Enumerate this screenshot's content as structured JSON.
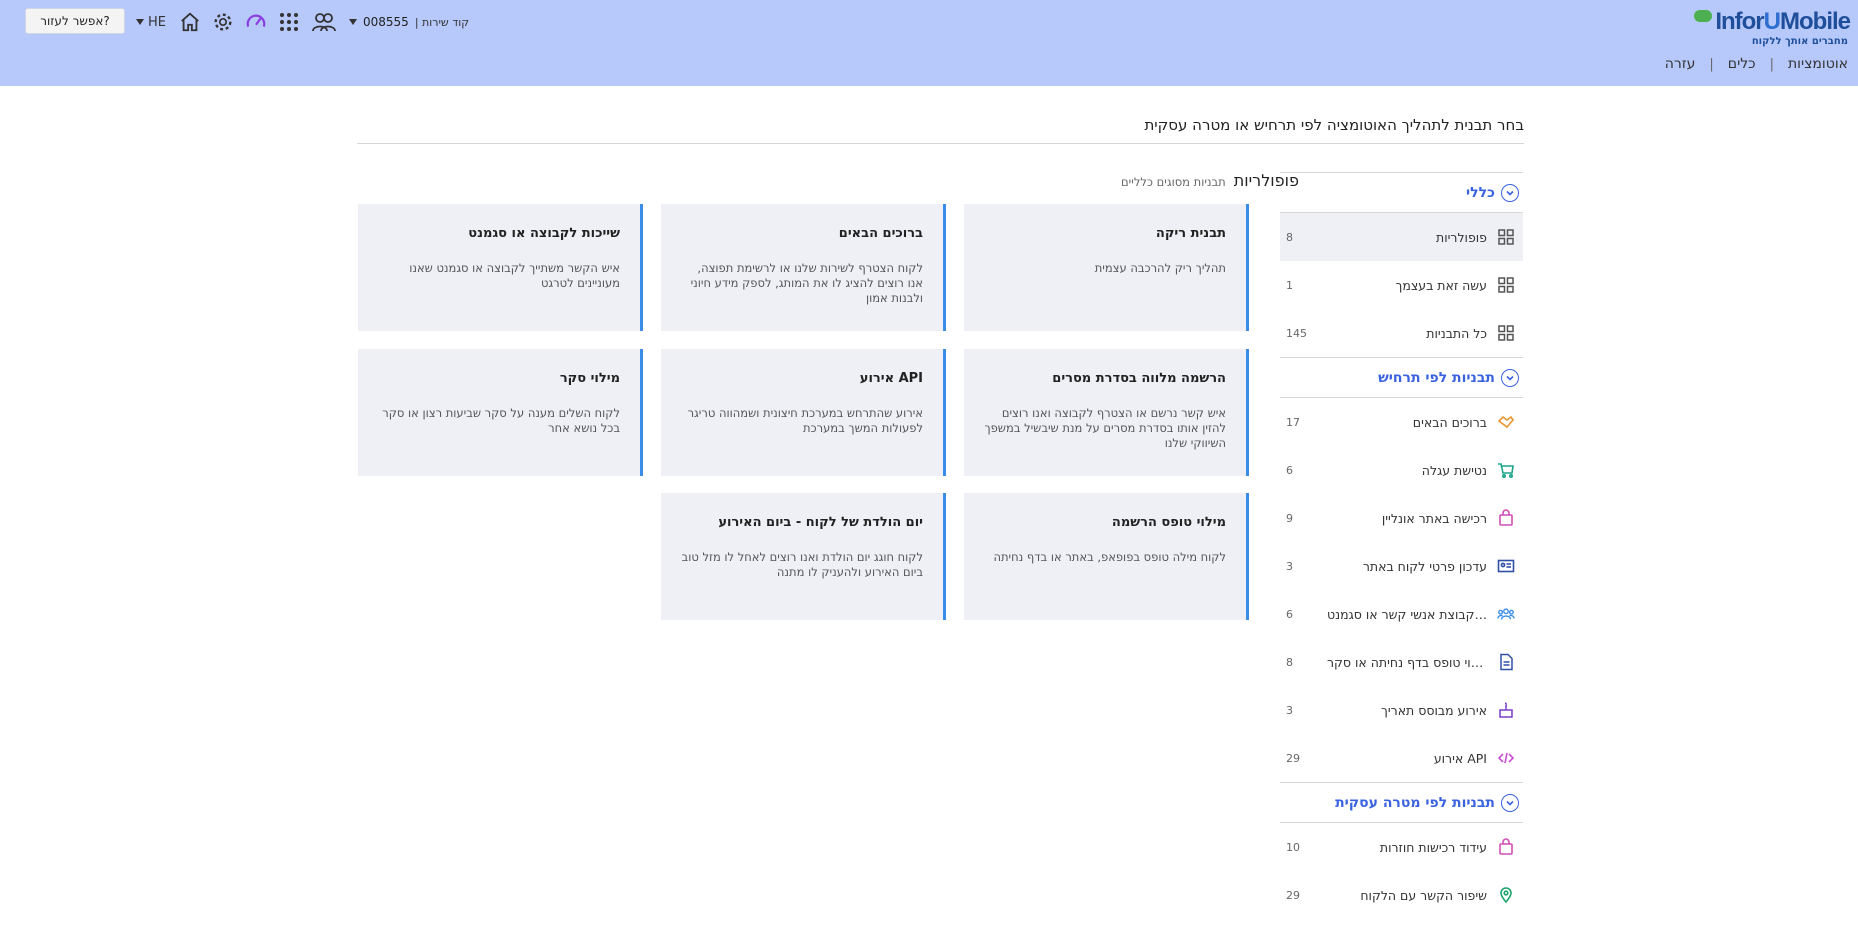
{
  "header": {
    "logo_text_a": "Infor",
    "logo_text_b": "U",
    "logo_text_c": "Mobile",
    "logo_tagline": "מחברים אותך ללקוח",
    "help_button": "אפשר לעזור?",
    "language": "HE",
    "service_code_label": "| קוד שירות",
    "service_code_value": "008555",
    "nav": [
      "אוטומציות",
      "כלים",
      "עזרה"
    ],
    "icons": [
      "home-icon",
      "settings-gear-icon",
      "speedometer-icon",
      "apps-grid-icon",
      "contacts-group-icon"
    ]
  },
  "page": {
    "title": "בחר תבנית לתהליך האוטומציה לפי תרחיש או מטרה עסקית"
  },
  "sidebar": {
    "sections": [
      {
        "label": "כללי",
        "items": [
          {
            "label": "פופולריות",
            "count": "8",
            "icon": "grid-icon",
            "active": true
          },
          {
            "label": "עשה זאת בעצמך",
            "count": "1",
            "icon": "grid-icon"
          },
          {
            "label": "כל התבניות",
            "count": "145",
            "icon": "grid-icon"
          }
        ]
      },
      {
        "label": "תבניות לפי תרחיש",
        "items": [
          {
            "label": "ברוכים הבאים",
            "count": "17",
            "icon": "handshake-icon"
          },
          {
            "label": "נטישת עגלה",
            "count": "6",
            "icon": "shopping-cart-icon"
          },
          {
            "label": "רכישה באתר אונליין",
            "count": "9",
            "icon": "shopping-bag-icon"
          },
          {
            "label": "עדכון פרטי לקוח באתר",
            "count": "3",
            "icon": "id-card-icon"
          },
          {
            "label": "שיוך לקבוצת אנשי קשר או סגמנט",
            "count": "6",
            "icon": "people-group-icon"
          },
          {
            "label": "מילוי טופס בדף נחיתה או סקר",
            "count": "8",
            "icon": "form-document-icon"
          },
          {
            "label": "אירוע מבוסס תאריך",
            "count": "3",
            "icon": "birthday-cake-icon"
          },
          {
            "label": "אירוע API",
            "count": "29",
            "icon": "code-icon"
          }
        ]
      },
      {
        "label": "תבניות לפי מטרה עסקית",
        "items": [
          {
            "label": "עידוד רכישות חוזרות",
            "count": "10",
            "icon": "shopping-bag-icon"
          },
          {
            "label": "שיפור הקשר עם הלקוח",
            "count": "29",
            "icon": "location-pin-icon"
          }
        ]
      }
    ]
  },
  "main": {
    "heading": "פופולריות",
    "subheading": "תבניות מסוגים כלליים",
    "cards": [
      {
        "title": "תבנית ריקה",
        "desc": "תהליך ריק להרכבה עצמית"
      },
      {
        "title": "ברוכים הבאים",
        "desc": "לקוח הצטרף לשירות שלנו או לרשימת תפוצה, אנו רוצים להציג לו את המותג, לספק מידע חיוני ולבנות אמון"
      },
      {
        "title": "שייכות לקבוצה או סגמנט",
        "desc": "איש הקשר משתייך לקבוצה או סגמנט שאנו מעוניינים לטרגט"
      },
      {
        "title": "הרשמה מלווה בסדרת מסרים",
        "desc": "איש קשר נרשם או הצטרף לקבוצה ואנו רוצים להזין אותו בסדרת מסרים על מנת שיבשיל במשפך השיווקי שלנו"
      },
      {
        "title": "אירוע API",
        "desc": "אירוע שהתרחש במערכת חיצונית ושמהווה טריגר לפעולות המשך במערכת"
      },
      {
        "title": "מילוי סקר",
        "desc": "לקוח השלים מענה על סקר שביעות רצון או סקר בכל נושא אחר"
      },
      {
        "title": "מילוי טופס הרשמה",
        "desc": "לקוח מילה טופס בפופאפ, באתר או בדף נחיתה"
      },
      {
        "title": "יום הולדת של לקוח - ביום האירוע",
        "desc": "לקוח חוגג יום הולדת ואנו רוצים לאחל לו מזל טוב ביום האירוע ולהעניק לו מתנה"
      }
    ]
  },
  "colors": {
    "topbar": "#b7c9fb",
    "accent": "#3b63e0",
    "card_bg": "#eef0f6",
    "card_border": "#3b8ce8"
  }
}
